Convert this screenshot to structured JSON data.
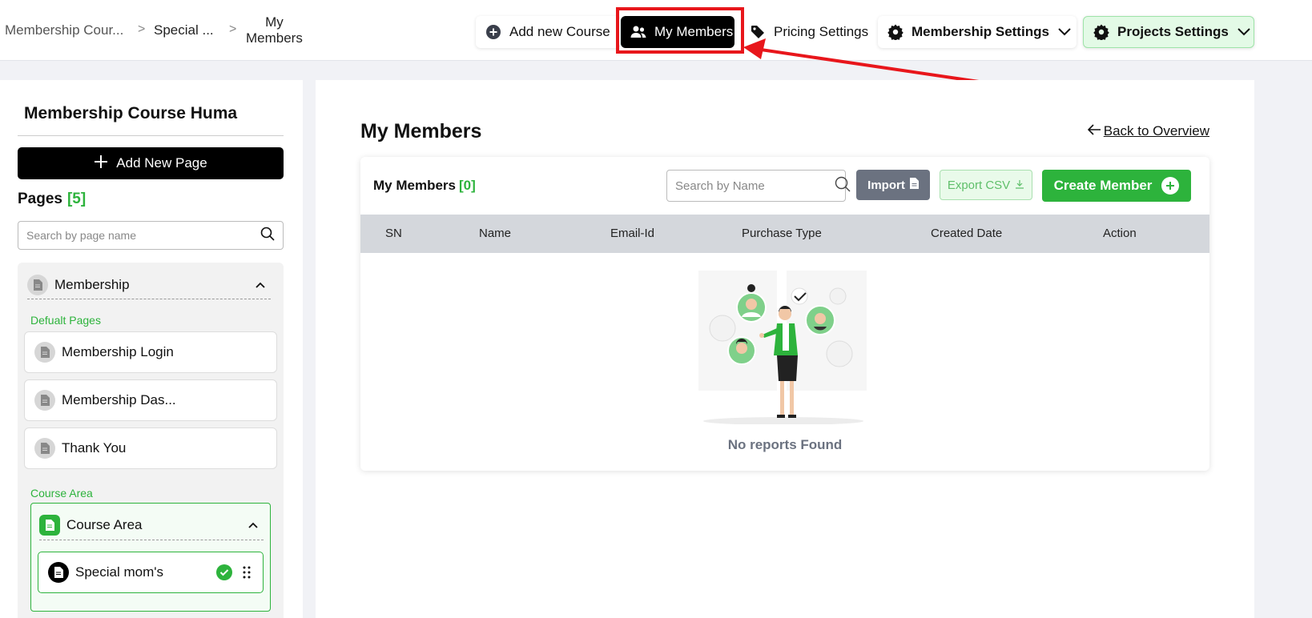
{
  "breadcrumb": {
    "items": [
      "Membership Cour...",
      "Special ...",
      "My Members"
    ],
    "current_line1": "My",
    "current_line2": "Members",
    "separator": ">"
  },
  "toolbar": {
    "add_course_label": "Add new Course",
    "my_members_label": "My Members",
    "pricing_label": "Pricing Settings",
    "membership_settings_label": "Membership Settings",
    "projects_settings_label": "Projects Settings"
  },
  "sidebar": {
    "title": "Membership Course Huma",
    "add_page_label": "Add New Page",
    "pages_label": "Pages",
    "pages_count": "[5]",
    "search_placeholder": "Search by page name",
    "group_label": "Membership",
    "default_pages_label": "Defualt Pages",
    "default_pages": [
      "Membership Login",
      "Membership Das...",
      "Thank You"
    ],
    "course_area_section_label": "Course Area",
    "course_area_group_label": "Course Area",
    "course_item_label": "Special mom's"
  },
  "main": {
    "title": "My Members",
    "back_link": "Back to Overview",
    "card": {
      "title": "My Members",
      "count": "[0]",
      "search_placeholder": "Search by Name",
      "import_label": "Import",
      "export_label": "Export CSV",
      "create_label": "Create Member",
      "columns": [
        "SN",
        "Name",
        "Email-Id",
        "Purchase Type",
        "Created Date",
        "Action"
      ],
      "empty_text": "No reports Found"
    }
  },
  "colors": {
    "accent_green": "#2db33c",
    "highlight_red": "#e8161b",
    "dark": "#000000",
    "table_header": "#d4d7dc"
  },
  "icons": [
    "plus-circle-icon",
    "users-icon",
    "tag-icon",
    "gear-icon",
    "chevron-down-icon",
    "chevron-up-icon",
    "document-icon",
    "search-icon",
    "file-icon",
    "download-icon",
    "check-circle-icon",
    "drag-handle-icon",
    "arrow-left-icon",
    "chevron-right-icon"
  ]
}
